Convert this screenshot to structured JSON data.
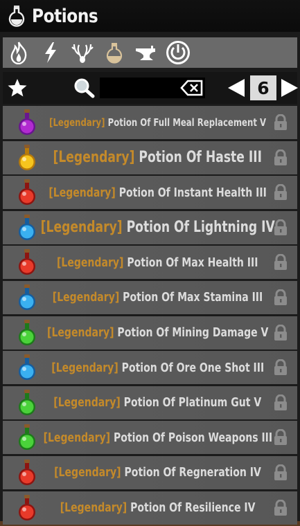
{
  "window": {
    "title": "Potions",
    "icon": "potion-flask-icon"
  },
  "categories": [
    {
      "id": "fire",
      "icon": "flame-icon"
    },
    {
      "id": "lightning",
      "icon": "lightning-icon"
    },
    {
      "id": "antlers",
      "icon": "antlers-icon"
    },
    {
      "id": "potion",
      "icon": "flask-icon",
      "selected": true
    },
    {
      "id": "anvil",
      "icon": "anvil-icon"
    },
    {
      "id": "power",
      "icon": "power-icon"
    }
  ],
  "filter": {
    "favorites_icon": "star-icon",
    "search_icon": "magnifier-icon",
    "search_value": "",
    "clear_icon": "backspace-icon",
    "page": "6"
  },
  "items": [
    {
      "tag": "[Legendary]",
      "name": "Potion Of Full Meal Replacement V",
      "color": "purple",
      "locked": true
    },
    {
      "tag": "[Legendary]",
      "name": "Potion Of Haste III",
      "color": "gold",
      "locked": true
    },
    {
      "tag": "[Legendary]",
      "name": "Potion Of Instant Health III",
      "color": "red",
      "locked": true
    },
    {
      "tag": "[Legendary]",
      "name": "Potion Of Lightning IV",
      "color": "blue",
      "locked": true
    },
    {
      "tag": "[Legendary]",
      "name": "Potion Of Max Health III",
      "color": "red",
      "locked": true
    },
    {
      "tag": "[Legendary]",
      "name": "Potion Of Max Stamina III",
      "color": "blue",
      "locked": true
    },
    {
      "tag": "[Legendary]",
      "name": "Potion Of Mining Damage V",
      "color": "green",
      "locked": true
    },
    {
      "tag": "[Legendary]",
      "name": "Potion Of Ore One Shot III",
      "color": "blue",
      "locked": true
    },
    {
      "tag": "[Legendary]",
      "name": "Potion Of Platinum Gut V",
      "color": "green",
      "locked": true
    },
    {
      "tag": "[Legendary]",
      "name": "Potion Of Poison Weapons III",
      "color": "green",
      "locked": true
    },
    {
      "tag": "[Legendary]",
      "name": "Potion Of Regneration IV",
      "color": "red",
      "locked": true
    },
    {
      "tag": "[Legendary]",
      "name": "Potion Of Resilience IV",
      "color": "red",
      "locked": true
    }
  ]
}
